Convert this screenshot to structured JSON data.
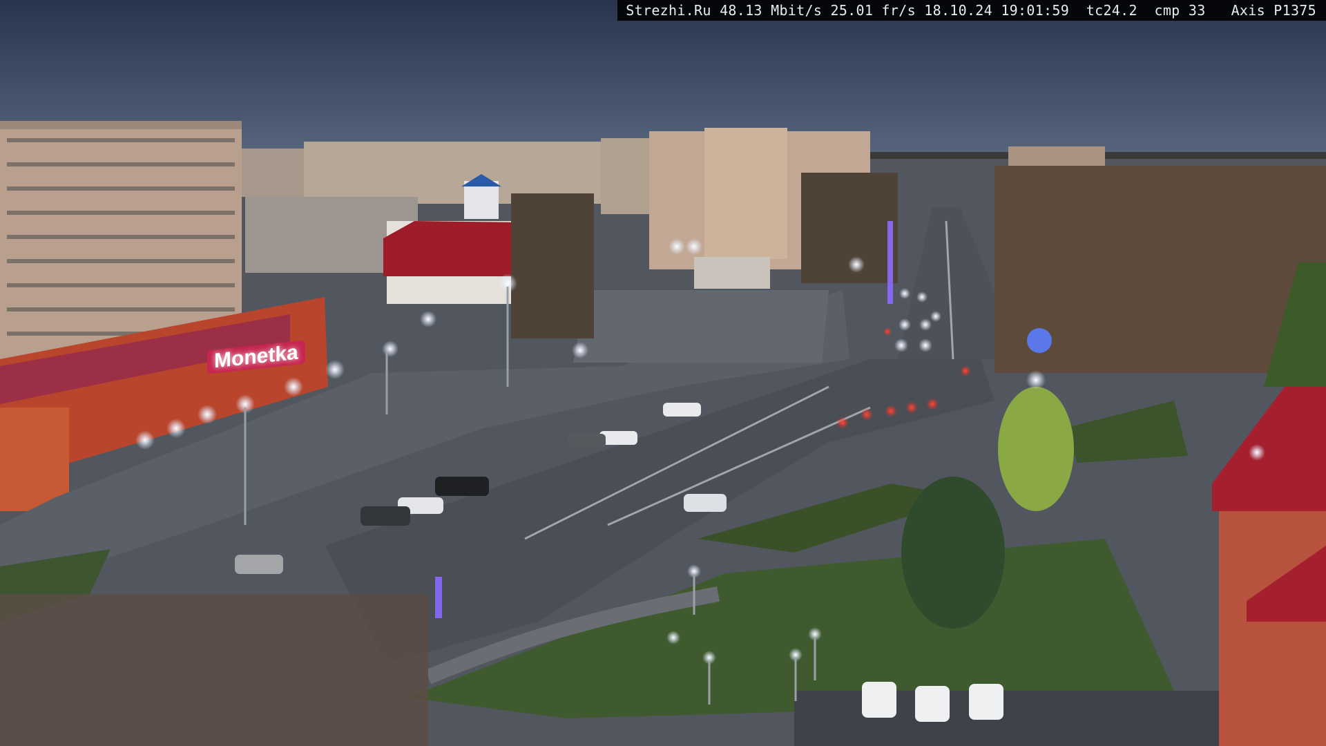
{
  "osd": {
    "site": "Strezhi.Ru",
    "bitrate": "48.13 Mbit/s",
    "framerate": "25.01 fr/s",
    "datetime": "18.10.24 19:01:59",
    "tc": "tc24.2",
    "cmp": "cmp 33",
    "camera": "Axis P1375"
  },
  "scene": {
    "store_sign": "Monetka"
  },
  "colors": {
    "sky_top": "#2b3a57",
    "sky_horizon": "#5a6a82",
    "asphalt": "#4b5058",
    "plaza": "#5b6068",
    "grass": "#3f5a2e",
    "building_brick": "#b9a08e",
    "store_red": "#b8452c",
    "roof_red": "#9c1c2a",
    "street_light": "#f4f7ff",
    "car_tail": "#ff3030"
  }
}
